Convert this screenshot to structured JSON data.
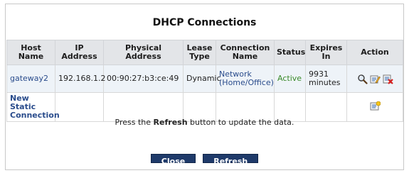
{
  "title": "DHCP Connections",
  "columns": [
    "Host Name",
    "IP Address",
    "Physical Address",
    "Lease Type",
    "Connection Name",
    "Status",
    "Expires In",
    "Action"
  ],
  "rows": [
    {
      "host": "gateway2",
      "ip": "192.168.1.2",
      "mac": "00:90:27:b3:ce:49",
      "lease": "Dynamic",
      "connection": "Network (Home/Office)",
      "status": "Active",
      "expires": "9931 minutes",
      "actions": [
        "details-magnifier-icon",
        "edit-pencil-icon",
        "delete-x-icon"
      ]
    }
  ],
  "new_static": {
    "label": "New Static Connection",
    "icon": "add-new-icon"
  },
  "note": {
    "prefix": "Press the ",
    "bold": "Refresh",
    "suffix": " button to update the data."
  },
  "buttons": {
    "close": "Close",
    "refresh": "Refresh"
  },
  "colors": {
    "link": "#2a4c8c",
    "active": "#3a8a2a",
    "button_bg": "#1f3a6a",
    "header_bg": "#e3e5e8",
    "row_bg": "#eef3f8"
  }
}
